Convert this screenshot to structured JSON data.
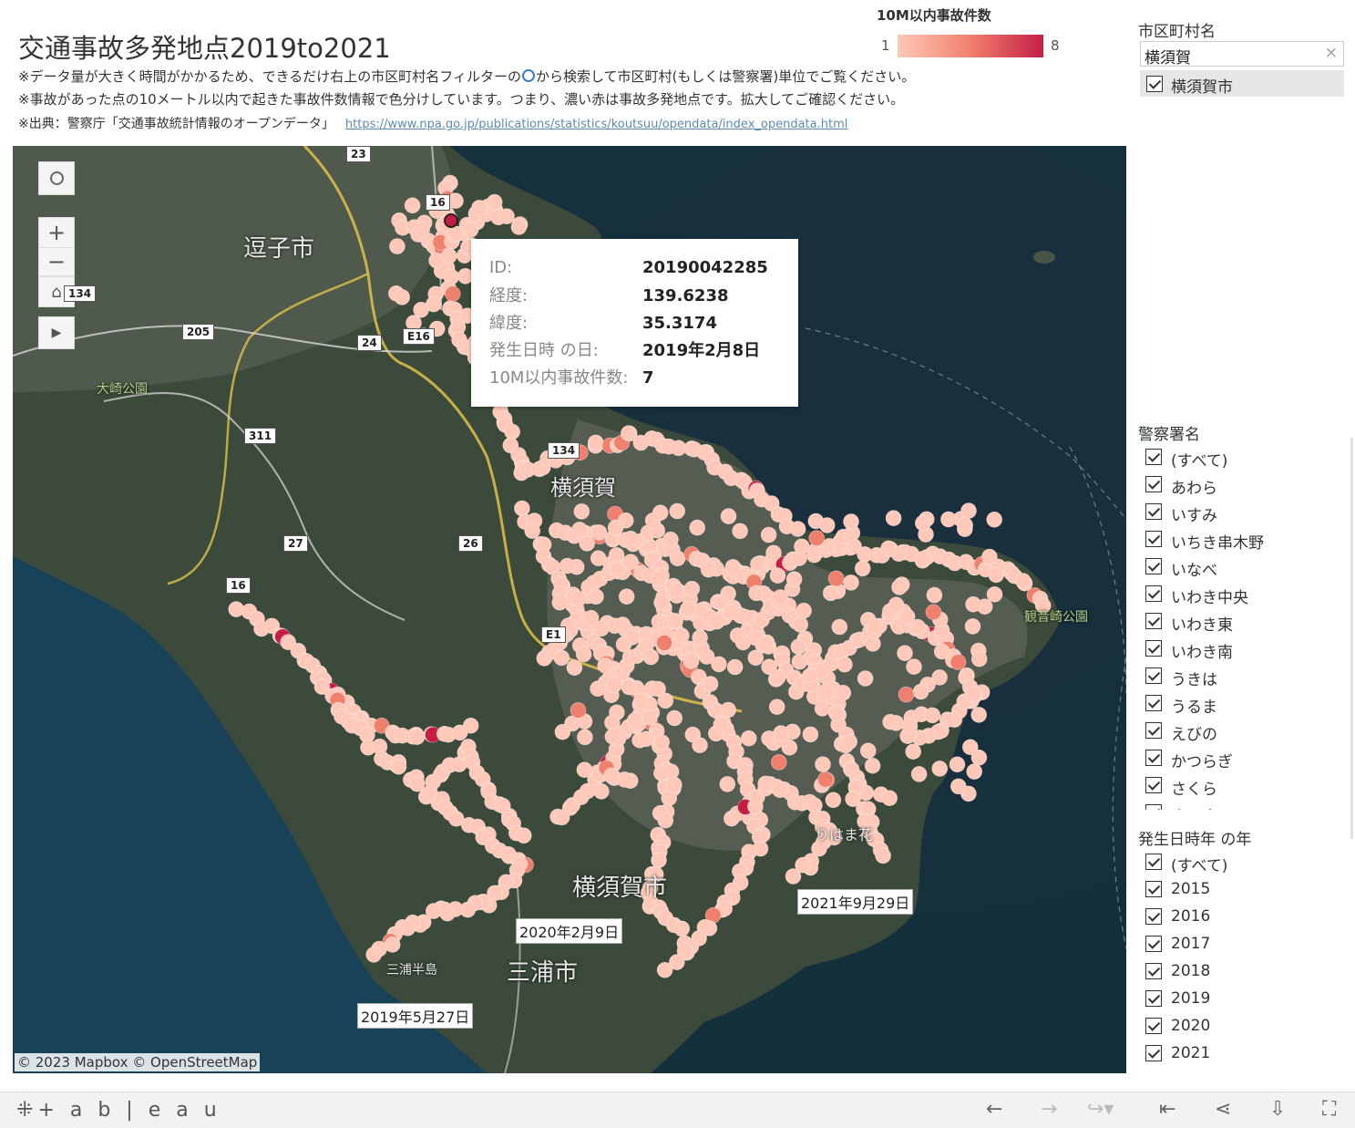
{
  "header": {
    "title": "交通事故多発地点2019to2021",
    "note1_a": "※データ量が大きく時間がかかるため、できるだけ右上の市区町村名フィルターの",
    "note1_b": "から検索して市区町村(もしくは警察署)単位でご覧ください。",
    "note2": "※事故があった点の10メートル以内で起きた事故件数情報で色分けしています。つまり、濃い赤は事故多発地点です。拡大してご確認ください。",
    "note3": "※出典：警察庁「交通事故統計情報のオープンデータ」",
    "link": "https://www.npa.go.jp/publications/statistics/koutsuu/opendata/index_opendata.html"
  },
  "legend": {
    "title": "10M以内事故件数",
    "min": "1",
    "max": "8",
    "colors": [
      "#ffc8b8",
      "#f0806e",
      "#c41e45"
    ]
  },
  "tooltip": {
    "rows": [
      {
        "label": "ID:",
        "value": "20190042285"
      },
      {
        "label": "経度:",
        "value": "139.6238"
      },
      {
        "label": "緯度:",
        "value": "35.3174"
      },
      {
        "label": "発生日時 の日:",
        "value": "2019年2月8日"
      },
      {
        "label": "10M以内事故件数:",
        "value": "7"
      }
    ]
  },
  "map": {
    "labels": {
      "zushi": "逗子市",
      "yokosuka": "横須賀市",
      "miura": "三浦市",
      "osaki": "大崎公園",
      "kannonzaki": "観音崎公園",
      "miura_hanto": "三浦半島",
      "yokosuka_partial": "横須賀",
      "hama": "りはま花"
    },
    "roads": [
      "16",
      "23",
      "134",
      "205",
      "24",
      "E16",
      "311",
      "27",
      "26",
      "134",
      "16",
      "E1"
    ],
    "annotations": [
      "2020年2月9日",
      "2021年9月29日",
      "2019年5月27日"
    ],
    "attribution": "© 2023 Mapbox  © OpenStreetMap",
    "controls": [
      "search-icon",
      "zoom-in-icon",
      "zoom-out-icon",
      "home-icon",
      "play-icon"
    ]
  },
  "filters": {
    "city": {
      "title": "市区町村名",
      "search_value": "横須賀",
      "clear": "×",
      "selected": "横須賀市"
    },
    "police": {
      "title": "警察署名",
      "items": [
        "(すべて)",
        "あわら",
        "いすみ",
        "いちき串木野",
        "いなべ",
        "いわき中央",
        "いわき東",
        "いわき南",
        "うきは",
        "うるま",
        "えびの",
        "かつらぎ",
        "さくら",
        "さつま"
      ]
    },
    "year": {
      "title": "発生日時年 の年",
      "items": [
        "(すべて)",
        "2015",
        "2016",
        "2017",
        "2018",
        "2019",
        "2020",
        "2021"
      ]
    }
  },
  "footer": {
    "logo": "+ a b | e a u",
    "icons": [
      "undo-icon",
      "redo-icon",
      "revert-icon",
      "first-icon",
      "share-icon",
      "download-icon",
      "fullscreen-icon"
    ]
  }
}
